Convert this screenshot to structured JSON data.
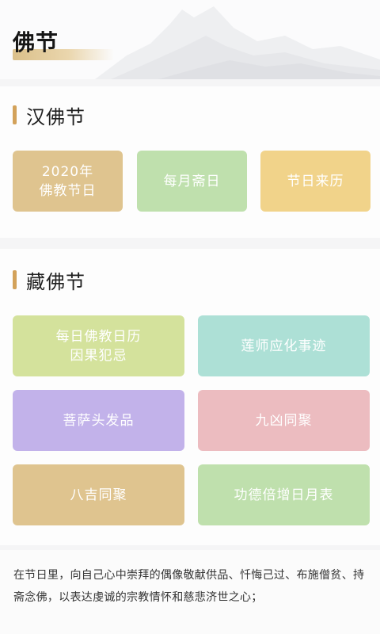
{
  "header": {
    "title": "佛节"
  },
  "han": {
    "title": "汉佛节",
    "tiles": [
      {
        "line1": "2020年",
        "line2": "佛教节日",
        "color": "#dfc48f"
      },
      {
        "line1": "每月斋日",
        "line2": "",
        "color": "#bfe0ad"
      },
      {
        "line1": "节日来历",
        "line2": "",
        "color": "#f1d38a"
      }
    ]
  },
  "zang": {
    "title": "藏佛节",
    "tiles": [
      {
        "line1": "每日佛教日历",
        "line2": "因果犯忌",
        "color": "#d4e29c"
      },
      {
        "line1": "莲师应化事迹",
        "line2": "",
        "color": "#ade0d6"
      },
      {
        "line1": "菩萨头发品",
        "line2": "",
        "color": "#c2b2ea"
      },
      {
        "line1": "九凶同聚",
        "line2": "",
        "color": "#ecbcc0"
      },
      {
        "line1": "八吉同聚",
        "line2": "",
        "color": "#dfc48f"
      },
      {
        "line1": "功德倍增日月表",
        "line2": "",
        "color": "#bfe0ad"
      }
    ]
  },
  "description": "在节日里，向自己心中崇拜的偶像敬献供品、忏悔己过、布施僧贫、持斋念佛，以表达虔诚的宗教情怀和慈悲济世之心；"
}
